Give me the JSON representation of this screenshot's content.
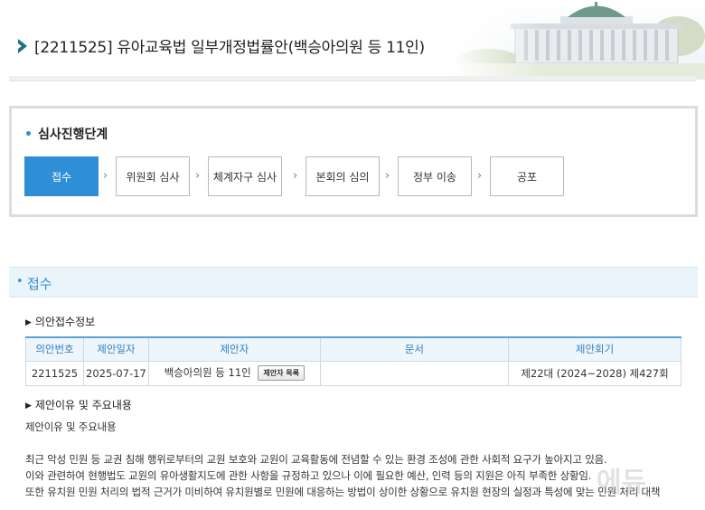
{
  "header": {
    "title": "[2211525] 유아교육법 일부개정법률안(백승아의원 등 11인)"
  },
  "stages": {
    "heading": "심사진행단계",
    "steps": [
      "접수",
      "위원회 심사",
      "체계자구 심사",
      "본회의 심의",
      "정부 이송",
      "공포"
    ],
    "active_index": 0
  },
  "section": {
    "title": "접수"
  },
  "receipt_info": {
    "heading": "의안접수정보",
    "columns": [
      "의안번호",
      "제안일자",
      "제안자",
      "문서",
      "제안회기"
    ],
    "row": {
      "bill_no": "2211525",
      "date": "2025-07-17",
      "proposer": "백승아의원 등 11인",
      "proposer_button": "제안자 목록",
      "document": "",
      "session": "제22대 (2024~2028) 제427회"
    }
  },
  "reason": {
    "heading": "제안이유 및 주요내용",
    "label": "제안이유 및 주요내용",
    "lines": [
      "최근 악성 민원 등 교권 침해 행위로부터의 교원 보호와 교원이 교육활동에 전념할 수 있는 환경 조성에 관한 사회적 요구가 높아지고 있음.",
      "이와 관련하여 현행법도 교원의 유아생활지도에 관한 사항을 규정하고 있으나 이에 필요한 예산, 인력 등의 지원은 아직 부족한 상황임.",
      "또한 유치원 민원 처리의 법적 근거가 미비하여 유치원별로 민원에 대응하는 방법이 상이한 상황으로 유치원 현장의 실정과 특성에 맞는 민원 처리 대책"
    ]
  },
  "watermark": "에듀",
  "colors": {
    "accent": "#2f8fd6",
    "section_bg": "#eaf4fb"
  }
}
